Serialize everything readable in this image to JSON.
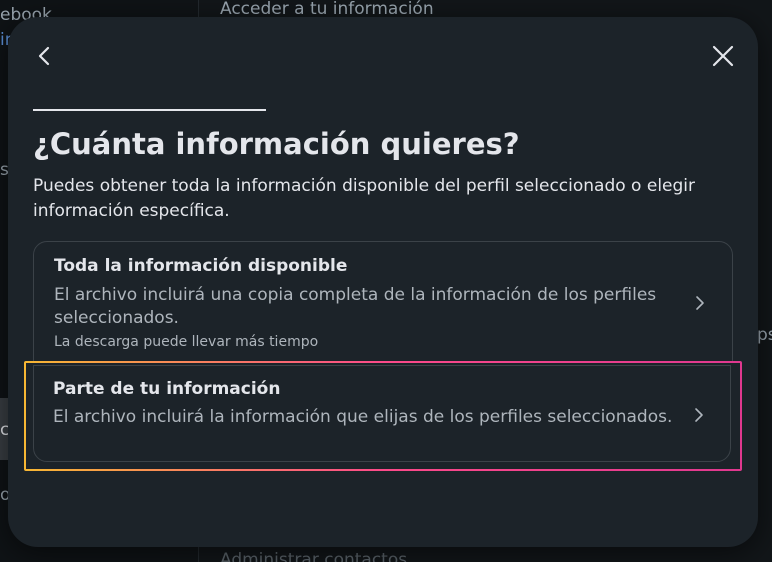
{
  "background": {
    "left_text_1": "ebook",
    "left_text_2": "in",
    "left_text_3": "s",
    "left_text_4": "co",
    "left_text_5": "os",
    "header_text": "Acceder a tu información",
    "right_text": "ps",
    "bottom_text": "Administrar contactos"
  },
  "dialog": {
    "title": "¿Cuánta información quieres?",
    "subtitle": "Puedes obtener toda la información disponible del perfil seleccionado o elegir información específica.",
    "options": [
      {
        "title": "Toda la información disponible",
        "description": "El archivo incluirá una copia completa de la información de los perfiles seleccionados.",
        "note": "La descarga puede llevar más tiempo"
      },
      {
        "title": "Parte de tu información",
        "description": "El archivo incluirá la información que elijas de los perfiles seleccionados."
      }
    ]
  },
  "icons": {
    "back": "chevron-left-icon",
    "close": "close-icon",
    "option_arrow": "chevron-right-icon"
  },
  "colors": {
    "modal_bg": "#1c2329",
    "text_primary": "#e4e6eb",
    "text_secondary": "#aeb5bc",
    "highlight_start": "#f7b733",
    "highlight_end": "#e0388f"
  }
}
